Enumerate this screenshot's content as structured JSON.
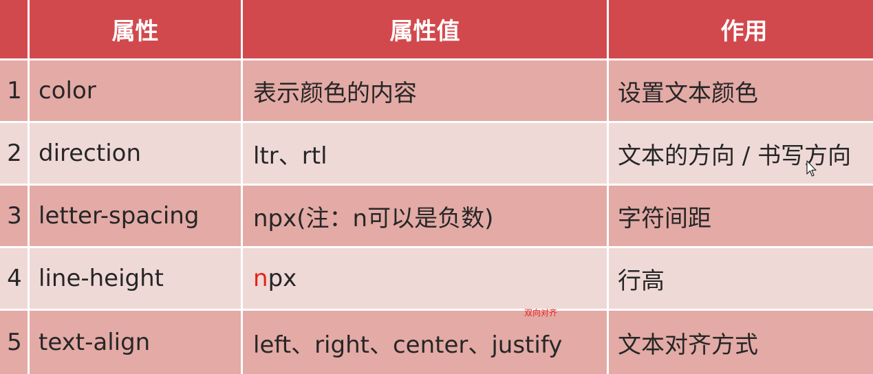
{
  "headers": {
    "index": "",
    "property": "属性",
    "value": "属性值",
    "usage": "作用"
  },
  "rows": [
    {
      "num": "1",
      "property": "color",
      "value": "表示颜色的内容",
      "usage": "设置文本颜色"
    },
    {
      "num": "2",
      "property": "direction",
      "value": "ltr、rtl",
      "usage": "文本的方向 / 书写方向"
    },
    {
      "num": "3",
      "property": "letter-spacing",
      "value": "npx(注：n可以是负数)",
      "usage": "字符间距"
    },
    {
      "num": "4",
      "property": "line-height",
      "value_highlight": "n",
      "value_rest": "px",
      "usage": "行高"
    },
    {
      "num": "5",
      "property": "text-align",
      "value": "left、right、center、justify",
      "usage": "文本对齐方式"
    }
  ],
  "annotation": "双向对齐",
  "colors": {
    "header": "#d2494d",
    "row_odd": "#e3aaa6",
    "row_even": "#eed9d6",
    "highlight": "#e1251b"
  },
  "icons": {
    "cursor": "mouse-pointer-icon"
  }
}
